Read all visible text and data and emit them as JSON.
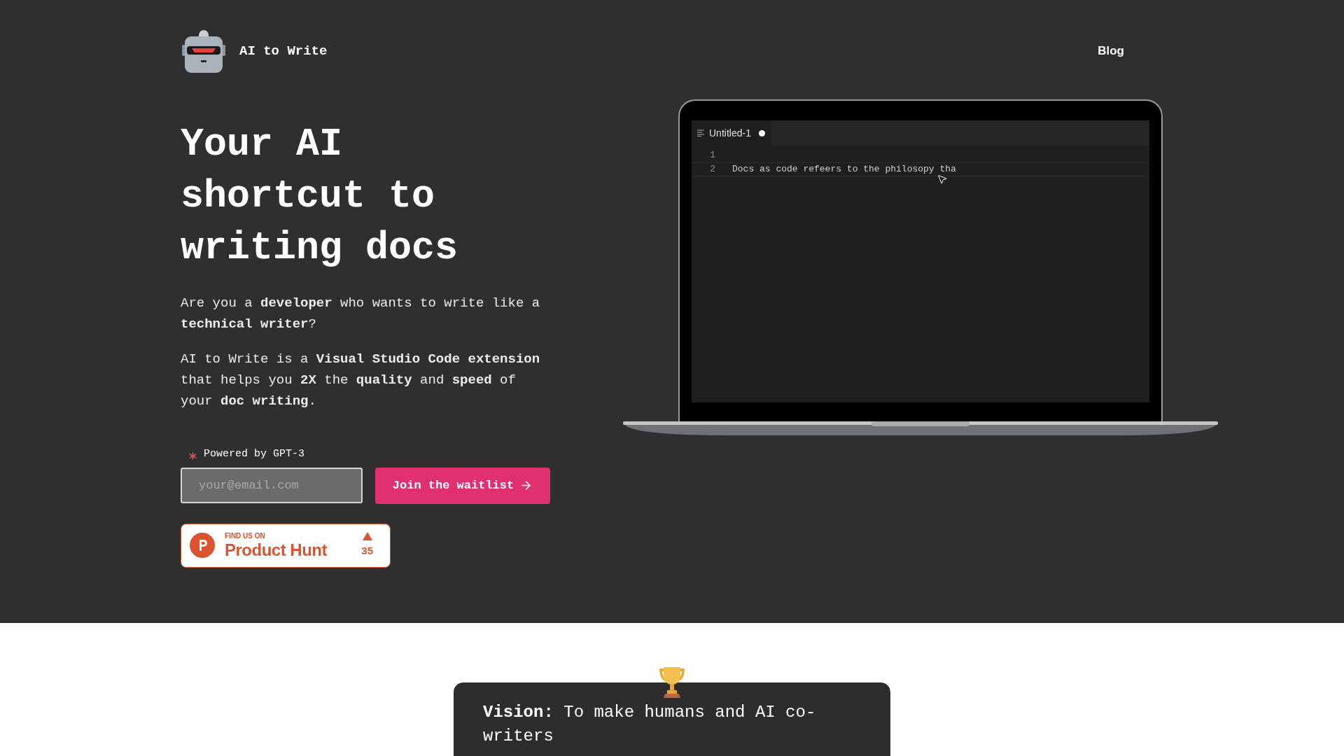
{
  "header": {
    "logo_text": "AI to Write",
    "nav": [
      {
        "label": "Blog"
      }
    ]
  },
  "hero": {
    "heading": "Your AI shortcut to writing docs",
    "paragraphs": [
      "Are you a **developer** who wants to write like a **technical writer**?",
      "AI to Write is a **Visual Studio Code extension** that helps you **2X** the **quality** and **speed** of your **doc writing**."
    ],
    "powered_by": "Powered by GPT-3",
    "email": {
      "placeholder": "your@email.com"
    },
    "cta": "Join the waitlist",
    "product_hunt": {
      "eyebrow": "FIND US ON",
      "name": "Product Hunt",
      "votes": "35"
    }
  },
  "editor": {
    "tab": {
      "title": "Untitled-1",
      "modified": true
    },
    "lines": [
      {
        "number": "1"
      },
      {
        "number": "2",
        "text": "Docs as code refeers to the philosopy tha"
      }
    ]
  },
  "vision": {
    "text": "**Vision:** To make humans and AI co-writers"
  }
}
